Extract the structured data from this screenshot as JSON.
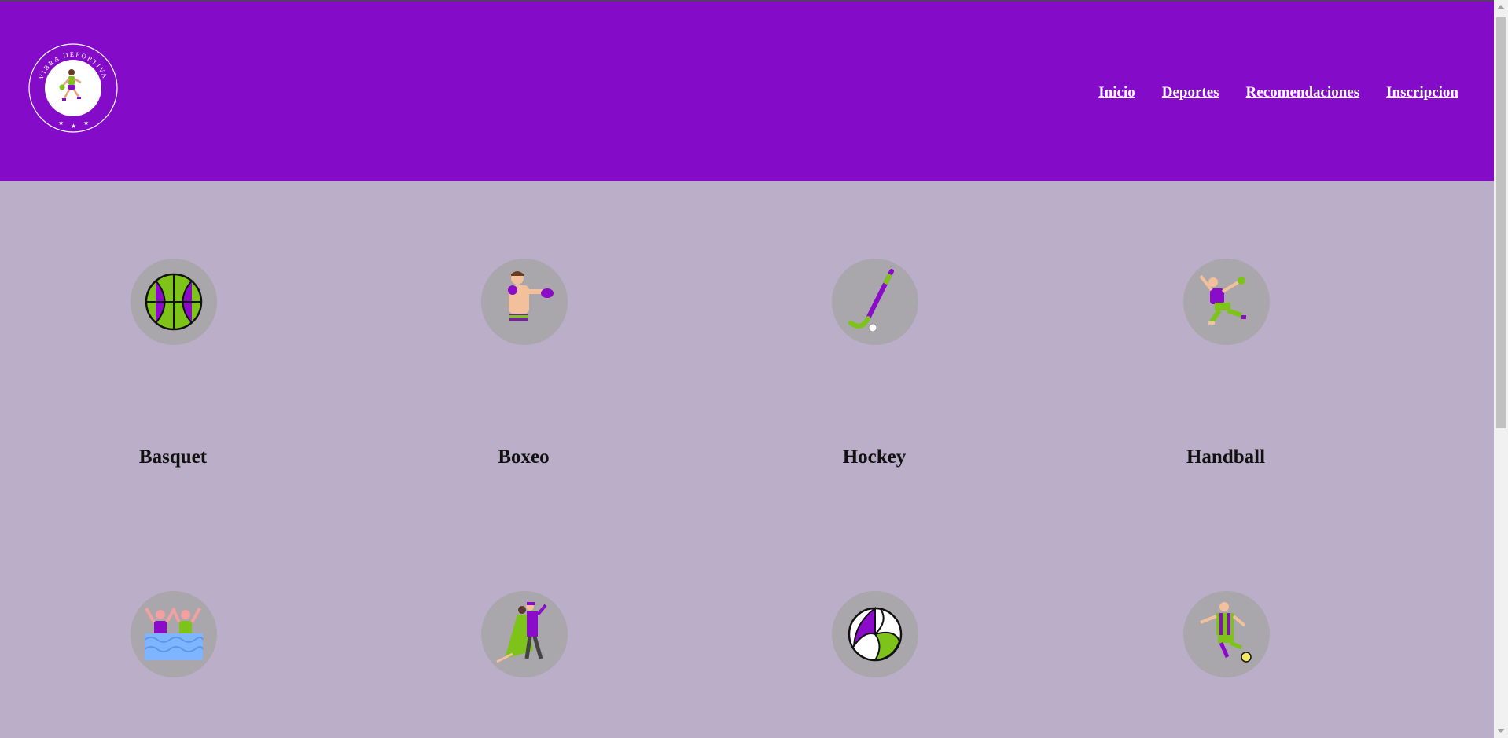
{
  "logo": {
    "ring_text": "VIBRA DEPORTIVA",
    "icon": "female-runner-logo"
  },
  "nav": {
    "items": [
      {
        "label": "Inicio"
      },
      {
        "label": "Deportes"
      },
      {
        "label": "Recomendaciones"
      },
      {
        "label": "Inscripcion"
      }
    ]
  },
  "sports": [
    {
      "label": "Basquet",
      "icon": "basketball-icon"
    },
    {
      "label": "Boxeo",
      "icon": "boxer-icon"
    },
    {
      "label": "Hockey",
      "icon": "hockey-stick-icon"
    },
    {
      "label": "Handball",
      "icon": "handball-player-icon"
    },
    {
      "label": "",
      "icon": "water-polo-icon"
    },
    {
      "label": "",
      "icon": "tango-dancers-icon"
    },
    {
      "label": "",
      "icon": "volleyball-icon"
    },
    {
      "label": "",
      "icon": "soccer-player-icon"
    }
  ],
  "colors": {
    "header": "#840cc8",
    "background": "#bbaec8",
    "icon_circle": "#a9a6ac",
    "accent_purple": "#8a0cc8",
    "accent_green": "#7ec31a"
  }
}
